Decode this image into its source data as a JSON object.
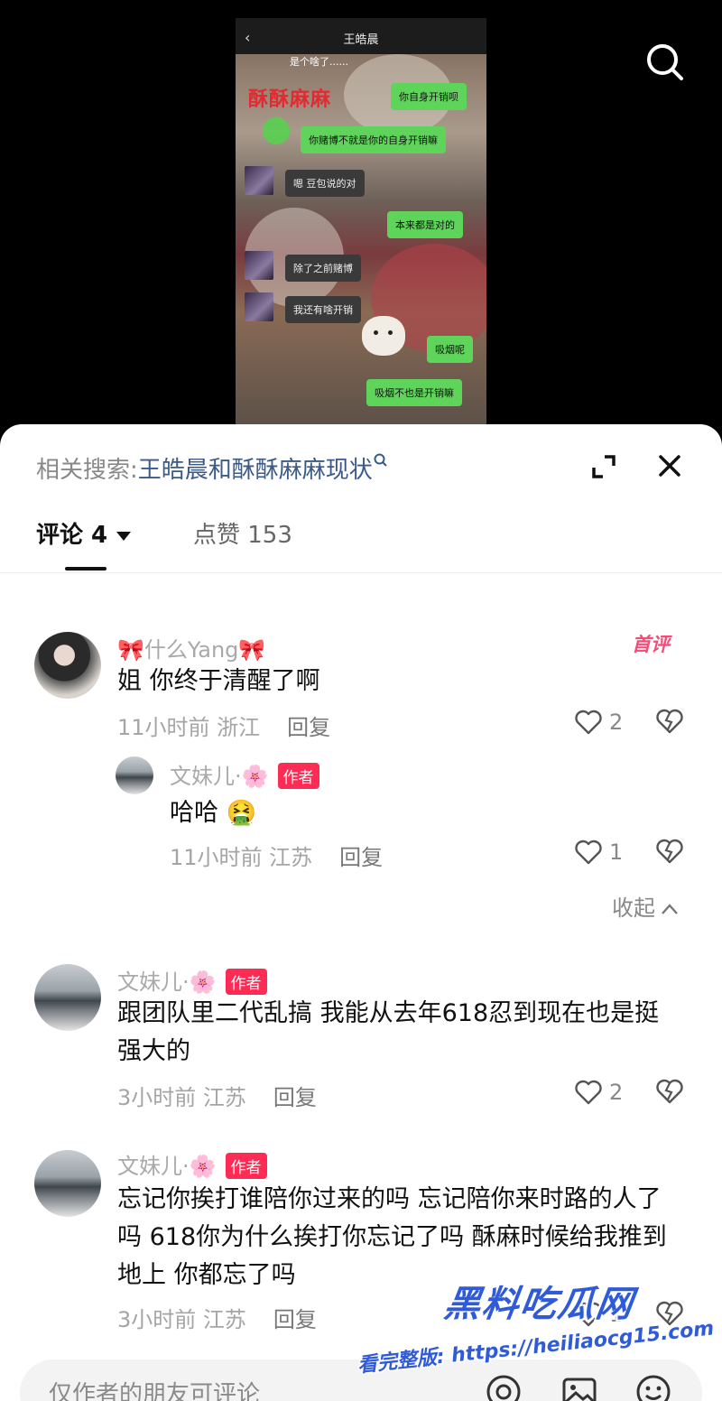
{
  "video": {
    "chat_title": "王皓晨",
    "chat_top_line": "是个啥了......",
    "chat_watermark": "酥酥麻麻",
    "messages": [
      {
        "side": "me",
        "text": "你自身开销呗"
      },
      {
        "side": "me",
        "text": "你赌博不就是你的自身开销嘛"
      },
      {
        "side": "other",
        "text": "嗯 豆包说的对"
      },
      {
        "side": "me",
        "text": "本来都是对的"
      },
      {
        "side": "other",
        "text": "除了之前赌博"
      },
      {
        "side": "other",
        "text": "我还有啥开销"
      },
      {
        "side": "me",
        "text": "吸烟呢"
      },
      {
        "side": "me",
        "text": "吸烟不也是开销嘛"
      }
    ]
  },
  "sheet": {
    "related_label": "相关搜索:",
    "related_query": "王皓晨和酥酥麻麻现状",
    "tabs": {
      "comments": "评论 4",
      "likes": "点赞 153"
    },
    "collapse_label": "收起"
  },
  "comments": [
    {
      "user": "🎀什么Yang🎀",
      "badge": "首评",
      "text": "姐 你终于清醒了啊",
      "meta": "11小时前 浙江",
      "reply": "回复",
      "likes": "2"
    },
    {
      "user": "文妹儿·🌸",
      "author_badge": "作者",
      "text": "哈哈 🤮",
      "meta": "11小时前 江苏",
      "reply": "回复",
      "likes": "1"
    },
    {
      "user": "文妹儿·🌸",
      "author_badge": "作者",
      "text": "跟团队里二代乱搞 我能从去年618忍到现在也是挺强大的",
      "meta": "3小时前 江苏",
      "reply": "回复",
      "likes": "2"
    },
    {
      "user": "文妹儿·🌸",
      "author_badge": "作者",
      "text": "忘记你挨打谁陪你过来的吗 忘记陪你来时路的人了吗  618你为什么挨打你忘记了吗  酥麻时候给我推到地上 你都忘了吗",
      "meta": "3小时前 江苏",
      "reply": "回复",
      "likes": "1"
    }
  ],
  "watermark": {
    "title": "黑料吃瓜网",
    "url": "看完整版: https://heiliaocg15.com"
  },
  "input": {
    "placeholder": "仅作者的朋友可评论"
  },
  "colors": {
    "accent": "#fe2c55",
    "link_blue": "#3b5a88",
    "bubble_green": "#5fd45a"
  }
}
